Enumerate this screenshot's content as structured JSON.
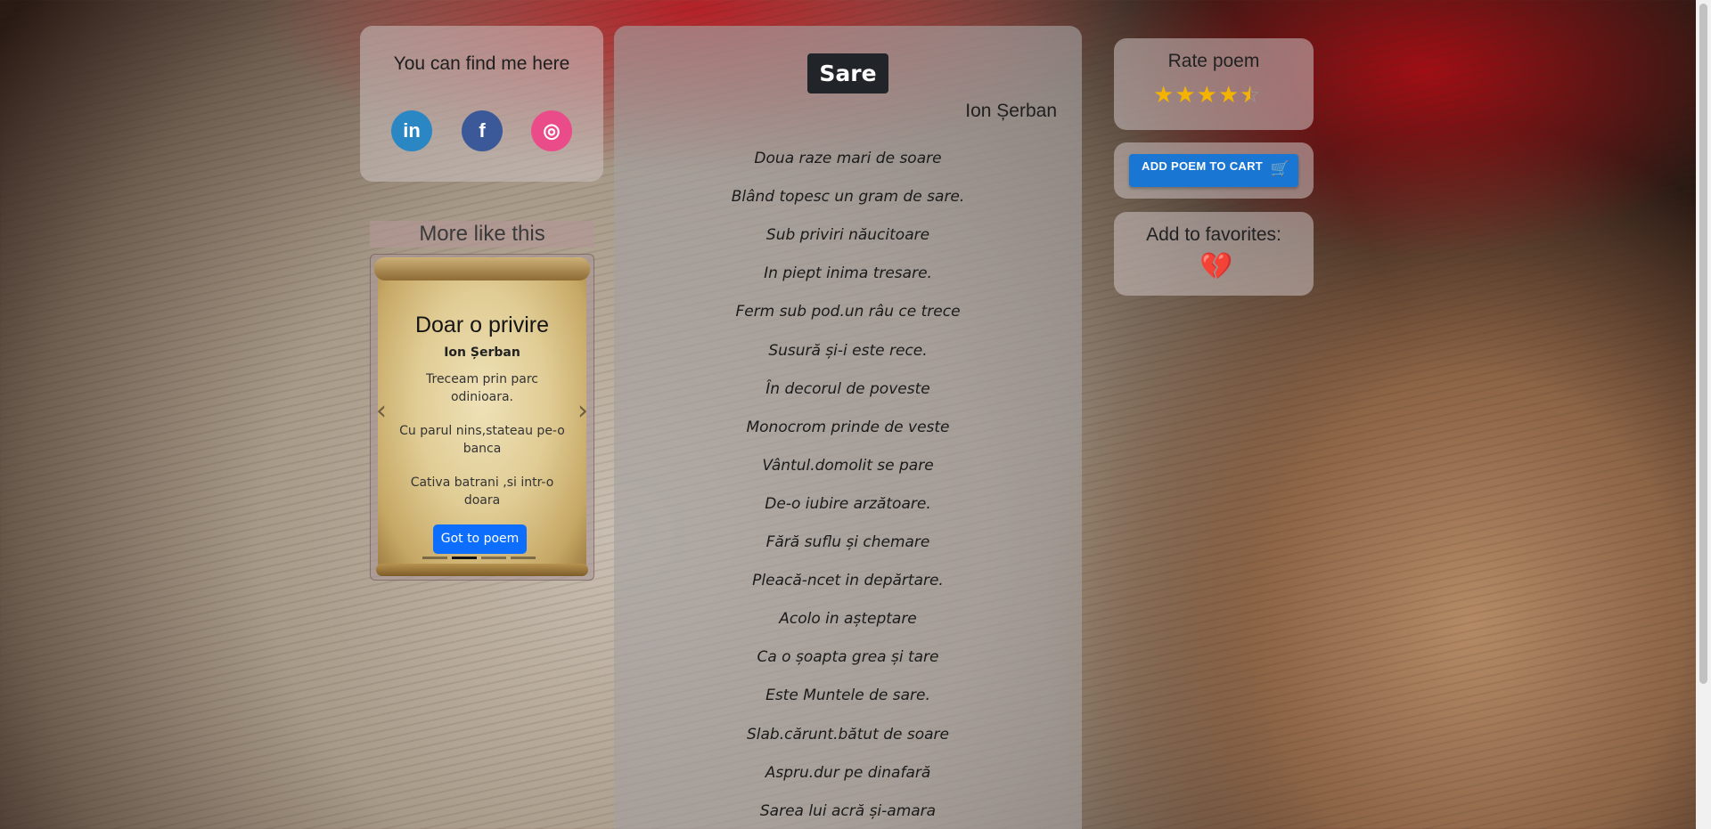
{
  "social": {
    "title": "You can find me here",
    "links": [
      {
        "label": "in",
        "icon": "linkedin-icon"
      },
      {
        "label": "f",
        "icon": "facebook-icon"
      },
      {
        "label": "◎",
        "icon": "instagram-icon"
      }
    ]
  },
  "more_like_this": {
    "title": "More like this",
    "card": {
      "title": "Doar o privire",
      "author": "Ion Șerban",
      "lines": [
        "Treceam prin parc odinioara.",
        "Cu parul nins,stateau pe-o banca",
        "Cativa batrani ,si intr-o doara"
      ],
      "button": "Got to poem",
      "slides": 4,
      "active_slide": 2
    },
    "prev_arrow": "‹",
    "next_arrow": "›"
  },
  "poem": {
    "title": "Sare",
    "author": "Ion Șerban",
    "verses": [
      "Doua raze mari de soare",
      "Blând topesc un gram de sare.",
      "Sub priviri năucitoare",
      "In piept inima tresare.",
      "Ferm sub pod.un râu ce trece",
      "Susură și-i este rece.",
      "În decorul de poveste",
      "Monocrom prinde de veste",
      "Vântul.domolit se pare",
      "De-o iubire arzătoare.",
      "Fără suflu și chemare",
      "Pleacă-ncet in depărtare.",
      "Acolo in așteptare",
      "Ca o șoapta grea și tare",
      "Este Muntele de sare.",
      "Slab.cărunt.bătut de soare",
      "Aspru.dur pe dinafară",
      "Sarea lui acră și-amara"
    ]
  },
  "rating": {
    "title": "Rate poem",
    "value": 4.5,
    "max": 5
  },
  "cart": {
    "button": "ADD POEM TO CART",
    "icon": "cart-icon"
  },
  "favorites": {
    "title": "Add to favorites:",
    "icon": "broken-heart-icon"
  },
  "colors": {
    "primary": "#0d6efd",
    "cart_button": "#1976d2",
    "star": "#f5b301",
    "title_badge": "#212529"
  }
}
